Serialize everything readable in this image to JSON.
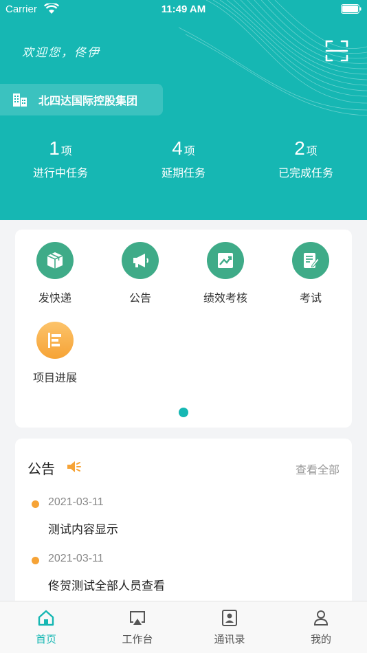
{
  "status_bar": {
    "carrier": "Carrier",
    "time": "11:49 AM"
  },
  "header": {
    "welcome": "欢迎您，佟伊",
    "company": "北四达国际控股集团",
    "stats": [
      {
        "num": "1",
        "unit": "项",
        "label": "进行中任务"
      },
      {
        "num": "4",
        "unit": "项",
        "label": "延期任务"
      },
      {
        "num": "2",
        "unit": "项",
        "label": "已完成任务"
      }
    ]
  },
  "grid": {
    "items": [
      {
        "label": "发快递",
        "icon": "package-icon"
      },
      {
        "label": "公告",
        "icon": "megaphone-icon"
      },
      {
        "label": "绩效考核",
        "icon": "chart-trend-icon"
      },
      {
        "label": "考试",
        "icon": "exam-icon"
      },
      {
        "label": "项目进展",
        "icon": "progress-bars-icon"
      }
    ],
    "page_count": 1,
    "current_page": 1
  },
  "notice": {
    "title": "公告",
    "view_all": "查看全部",
    "items": [
      {
        "date": "2021-03-11",
        "text": "测试内容显示"
      },
      {
        "date": "2021-03-11",
        "text": "佟贺测试全部人员查看"
      }
    ]
  },
  "tabbar": {
    "tabs": [
      {
        "label": "首页",
        "icon": "home-icon",
        "active": true
      },
      {
        "label": "工作台",
        "icon": "airplay-icon",
        "active": false
      },
      {
        "label": "通讯录",
        "icon": "contacts-icon",
        "active": false
      },
      {
        "label": "我的",
        "icon": "person-icon",
        "active": false
      }
    ]
  },
  "colors": {
    "primary": "#16b7b3",
    "icon_green": "#3fab88",
    "icon_orange": "#f6a336",
    "bullet": "#f6a336"
  }
}
